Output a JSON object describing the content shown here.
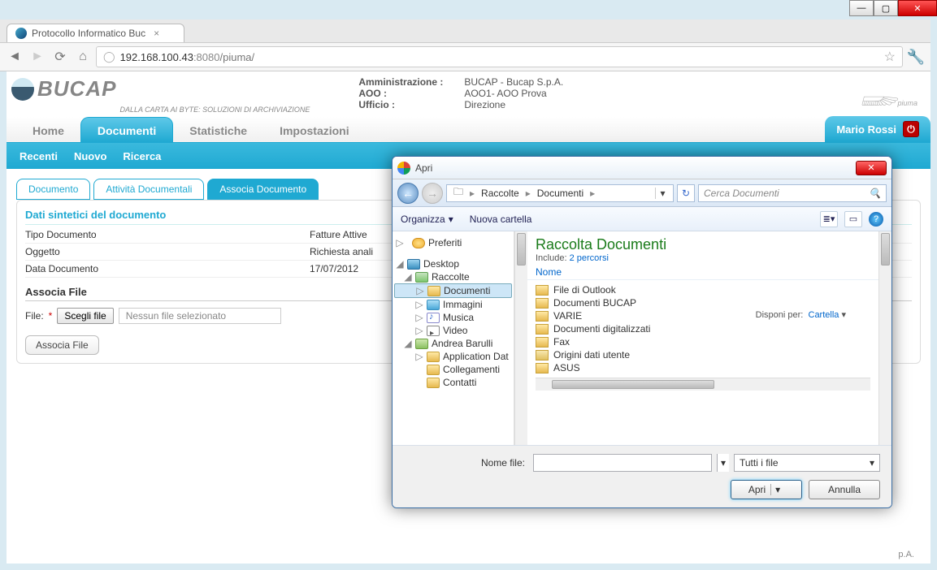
{
  "window": {
    "tab_title": "Protocollo Informatico Buc",
    "min": "—",
    "max": "▢",
    "close": "✕"
  },
  "url": {
    "host": "192.168.100.43",
    "port": ":8080",
    "path": "/piuma/"
  },
  "header": {
    "logo_word": "BUCAP",
    "tagline": "DALLA CARTA AI BYTE: SOLUZIONI DI ARCHIVIAZIONE",
    "admin_label": "Amministrazione :",
    "admin_value": "BUCAP - Bucap S.p.A.",
    "aoo_label": "AOO :",
    "aoo_value": "AOO1- AOO Prova",
    "ufficio_label": "Ufficio :",
    "ufficio_value": "Direzione",
    "feather": "piuma"
  },
  "main_tabs": {
    "home": "Home",
    "documenti": "Documenti",
    "statistiche": "Statistiche",
    "impostazioni": "Impostazioni"
  },
  "user": {
    "name": "Mario Rossi",
    "power": "⏻"
  },
  "sub_tabs": {
    "recenti": "Recenti",
    "nuovo": "Nuovo",
    "ricerca": "Ricerca"
  },
  "inner_tabs": {
    "documento": "Documento",
    "attivita": "Attività Documentali",
    "associa": "Associa Documento"
  },
  "panel": {
    "section_title": "Dati sintetici del documento",
    "rows": [
      {
        "k": "Tipo Documento",
        "v": "Fatture Attive"
      },
      {
        "k": "Oggetto",
        "v": "Richiesta anali"
      },
      {
        "k": "Data Documento",
        "v": "17/07/2012"
      }
    ],
    "assoc_title": "Associa File",
    "file_label": "File:",
    "required": "*",
    "choose": "Scegli file",
    "no_file": "Nessun file selezionato",
    "assoc_btn": "Associa File"
  },
  "footer_fragment": "p.A.",
  "dialog": {
    "title": "Apri",
    "back": "←",
    "fwd": "→",
    "crumbs": [
      "Raccolte",
      "Documenti"
    ],
    "crumb_sep": "▸",
    "crumb_drop": "▾",
    "refresh": "↻",
    "search_ph": "Cerca Documenti",
    "search_icon": "🔍",
    "toolbar": {
      "organize": "Organizza",
      "organize_drop": "▾",
      "newfolder": "Nuova cartella",
      "view": "≣",
      "view_drop": "▾",
      "pane": "▭",
      "help": "?"
    },
    "tree": {
      "preferiti": "Preferiti",
      "desktop": "Desktop",
      "raccolte": "Raccolte",
      "documenti": "Documenti",
      "immagini": "Immagini",
      "musica": "Musica",
      "video": "Video",
      "user": "Andrea Barulli",
      "appdata": "Application Dat",
      "colleg": "Collegamenti",
      "contatti": "Contatti"
    },
    "list": {
      "title": "Raccolta Documenti",
      "include_lbl": "Include:",
      "include_link": "2 percorsi",
      "arrange_lbl": "Disponi per:",
      "arrange_val": "Cartella",
      "col_name": "Nome",
      "items": [
        "File di Outlook",
        "Documenti BUCAP",
        "VARIE",
        "Documenti digitalizzati",
        "Fax",
        "Origini dati utente",
        "ASUS"
      ]
    },
    "bottom": {
      "fname_lbl": "Nome file:",
      "filter": "Tutti i file",
      "open": "Apri",
      "open_drop": "▾",
      "cancel": "Annulla"
    }
  }
}
